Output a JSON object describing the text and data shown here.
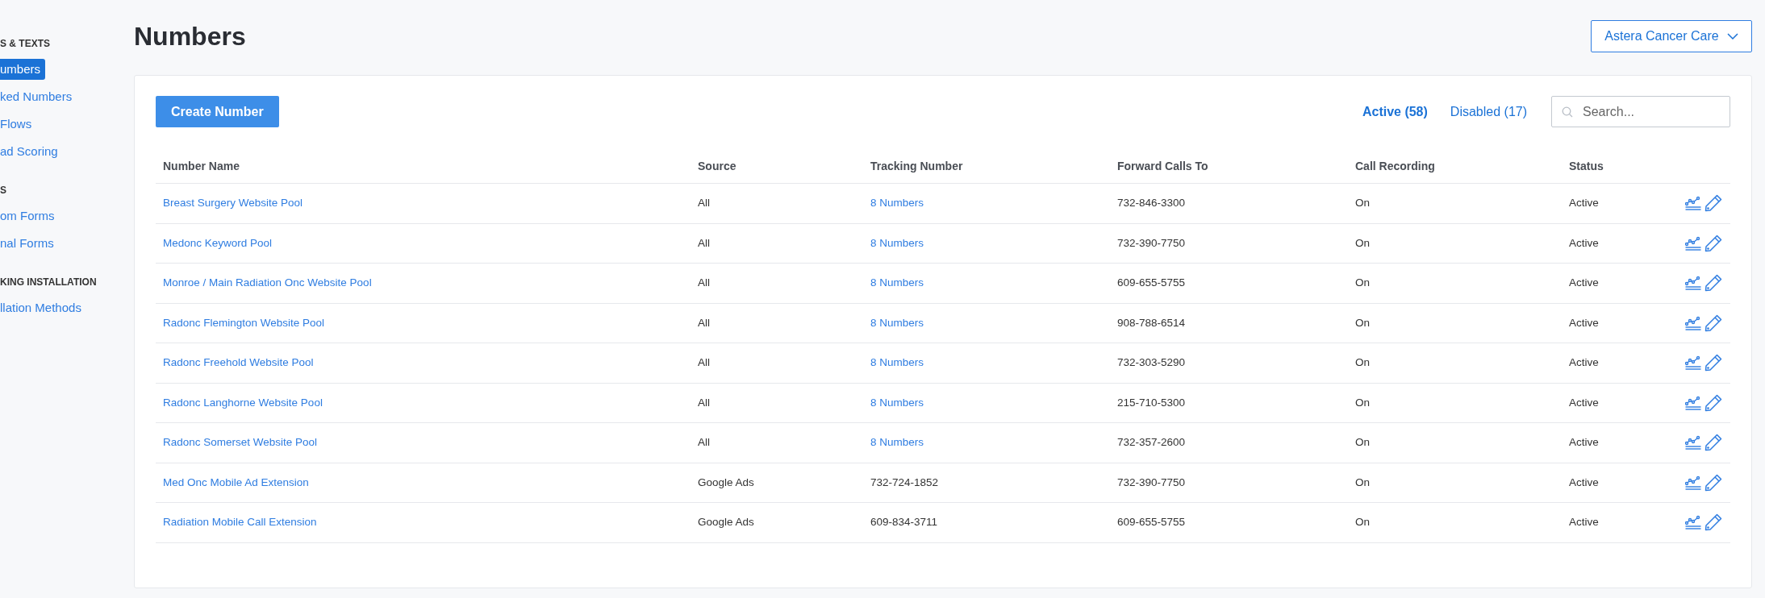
{
  "sidebar": {
    "sections": [
      {
        "heading": "S & TEXTS",
        "items": [
          {
            "label": "umbers",
            "selected": true
          },
          {
            "label": "ked Numbers",
            "selected": false
          },
          {
            "label": "Flows",
            "selected": false
          },
          {
            "label": "ad Scoring",
            "selected": false
          }
        ]
      },
      {
        "heading": "S",
        "items": [
          {
            "label": "om Forms",
            "selected": false
          },
          {
            "label": "nal Forms",
            "selected": false
          }
        ]
      },
      {
        "heading": "KING INSTALLATION",
        "items": [
          {
            "label": "llation Methods",
            "selected": false
          }
        ]
      }
    ]
  },
  "page_title": "Numbers",
  "account_dropdown": {
    "label": "Astera Cancer Care"
  },
  "create_button": "Create Number",
  "filter_tabs": [
    {
      "label": "Active (58)",
      "selected": true
    },
    {
      "label": "Disabled (17)",
      "selected": false
    }
  ],
  "search": {
    "placeholder": "Search..."
  },
  "table": {
    "columns": [
      "Number Name",
      "Source",
      "Tracking Number",
      "Forward Calls To",
      "Call Recording",
      "Status"
    ],
    "rows": [
      {
        "name": "Breast Surgery Website Pool",
        "source": "All",
        "tracking": {
          "kind": "link",
          "text": "8 Numbers"
        },
        "forward": "732-846-3300",
        "recording": "On",
        "status": "Active"
      },
      {
        "name": "Medonc Keyword Pool",
        "source": "All",
        "tracking": {
          "kind": "link",
          "text": "8 Numbers"
        },
        "forward": "732-390-7750",
        "recording": "On",
        "status": "Active"
      },
      {
        "name": "Monroe / Main Radiation Onc Website Pool",
        "source": "All",
        "tracking": {
          "kind": "link",
          "text": "8 Numbers"
        },
        "forward": "609-655-5755",
        "recording": "On",
        "status": "Active"
      },
      {
        "name": "Radonc Flemington Website Pool",
        "source": "All",
        "tracking": {
          "kind": "link",
          "text": "8 Numbers"
        },
        "forward": "908-788-6514",
        "recording": "On",
        "status": "Active"
      },
      {
        "name": "Radonc Freehold Website Pool",
        "source": "All",
        "tracking": {
          "kind": "link",
          "text": "8 Numbers"
        },
        "forward": "732-303-5290",
        "recording": "On",
        "status": "Active"
      },
      {
        "name": "Radonc Langhorne Website Pool",
        "source": "All",
        "tracking": {
          "kind": "link",
          "text": "8 Numbers"
        },
        "forward": "215-710-5300",
        "recording": "On",
        "status": "Active"
      },
      {
        "name": "Radonc Somerset Website Pool",
        "source": "All",
        "tracking": {
          "kind": "link",
          "text": "8 Numbers"
        },
        "forward": "732-357-2600",
        "recording": "On",
        "status": "Active"
      },
      {
        "name": "Med Onc Mobile Ad Extension",
        "source": "Google Ads",
        "tracking": {
          "kind": "text",
          "text": "732-724-1852"
        },
        "forward": "732-390-7750",
        "recording": "On",
        "status": "Active"
      },
      {
        "name": "Radiation Mobile Call Extension",
        "source": "Google Ads",
        "tracking": {
          "kind": "text",
          "text": "609-834-3711"
        },
        "forward": "609-655-5755",
        "recording": "On",
        "status": "Active"
      }
    ]
  }
}
